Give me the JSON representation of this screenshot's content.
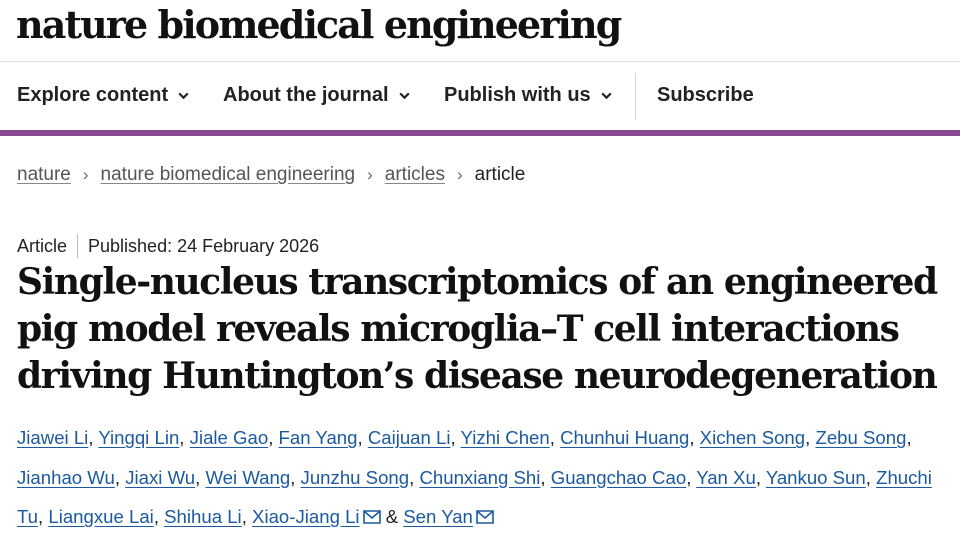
{
  "journal": {
    "logo_text": "nature biomedical engineering"
  },
  "nav": {
    "explore": "Explore content",
    "about": "About the journal",
    "publish": "Publish with us",
    "subscribe": "Subscribe"
  },
  "breadcrumb": {
    "nature": "nature",
    "journal": "nature biomedical engineering",
    "articles": "articles",
    "current": "article",
    "separator": "›"
  },
  "article": {
    "type": "Article",
    "published": "Published: 24 February 2026",
    "title": "Single-nucleus transcriptomics of an engineered pig model reveals microglia–T cell interactions driving Huntington’s disease neurodegeneration"
  },
  "authors": {
    "list": [
      "Jiawei Li",
      "Yingqi Lin",
      "Jiale Gao",
      "Fan Yang",
      "Caijuan Li",
      "Yizhi Chen",
      "Chunhui Huang",
      "Xichen Song",
      "Zebu Song",
      "Jianhao Wu",
      "Jiaxi Wu",
      "Wei Wang",
      "Junzhu Song",
      "Chunxiang Shi",
      "Guangchao Cao",
      "Yan Xu",
      "Yankuo Sun",
      "Zhuchi Tu",
      "Liangxue Lai",
      "Shihua Li",
      "Xiao-Jiang Li",
      "Sen Yan"
    ],
    "separator": ", ",
    "conjunction": " & "
  },
  "colors": {
    "accent_bar": "#8a4a8f",
    "link": "#1b5aa0",
    "text": "#222222"
  },
  "icons": {
    "nav_dropdown": "chevron-down-icon",
    "corresponding_author": "mail-icon"
  }
}
